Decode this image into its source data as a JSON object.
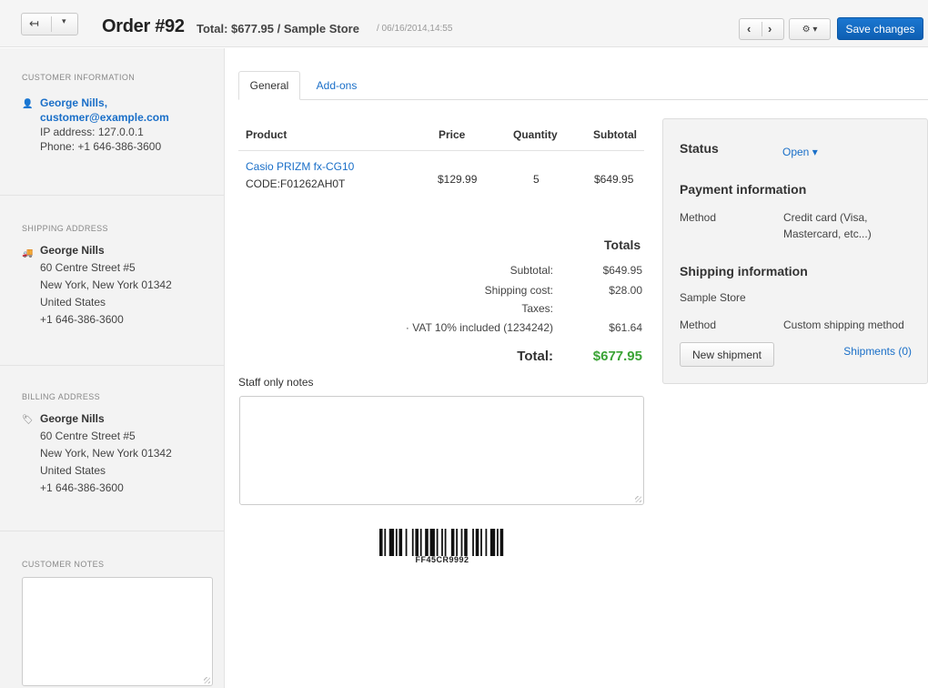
{
  "header": {
    "back_icon": "↤",
    "dropdown_icon": "▾",
    "title": "Order #92",
    "summary": "Total: $677.95 / Sample Store",
    "date": "/ 06/16/2014,14:55",
    "prev_icon": "‹",
    "next_icon": "›",
    "gear_icon": "⚙ ▾",
    "save_label": "Save changes"
  },
  "sidebar": {
    "customer": {
      "heading": "CUSTOMER INFORMATION",
      "icon": "👤",
      "name": "George Nills,",
      "email": "customer@example.com",
      "ip": "IP address: 127.0.0.1",
      "phone": "Phone: +1 646-386-3600"
    },
    "shipping": {
      "heading": "SHIPPING ADDRESS",
      "icon": "🚚",
      "name": "George Nills",
      "street": "60 Centre Street #5",
      "city": "New York, New York 01342",
      "country": "United States",
      "phone": "+1 646-386-3600"
    },
    "billing": {
      "heading": "BILLING ADDRESS",
      "icon": "🏷",
      "name": "George Nills",
      "street": "60 Centre Street #5",
      "city": "New York, New York 01342",
      "country": "United States",
      "phone": "+1 646-386-3600"
    },
    "notes_heading": "CUSTOMER NOTES",
    "notes_value": ""
  },
  "tabs": [
    {
      "label": "General",
      "active": true
    },
    {
      "label": "Add-ons",
      "active": false
    }
  ],
  "products": {
    "columns": [
      "Product",
      "Price",
      "Quantity",
      "Subtotal"
    ],
    "rows": [
      {
        "name": "Casio PRIZM fx-CG10",
        "code": "CODE:F01262AH0T",
        "price": "$129.99",
        "quantity": "5",
        "subtotal": "$649.95"
      }
    ]
  },
  "totals": {
    "title": "Totals",
    "subtotal_label": "Subtotal:",
    "subtotal_value": "$649.95",
    "shipping_label": "Shipping cost:",
    "shipping_value": "$28.00",
    "taxes_label": "Taxes:",
    "vat_label": "· VAT 10% included (1234242)",
    "vat_value": "$61.64",
    "total_label": "Total:",
    "total_value": "$677.95"
  },
  "staff_notes": {
    "label": "Staff only notes",
    "value": ""
  },
  "barcode": {
    "text": "FF45CR9992"
  },
  "info_panel": {
    "status_label": "Status",
    "status_value": "Open ▾",
    "payment_heading": "Payment information",
    "payment_method_label": "Method",
    "payment_method_value": "Credit card (Visa, Mastercard, etc...)",
    "shipping_heading": "Shipping information",
    "shipping_store": "Sample Store",
    "shipping_method_label": "Method",
    "shipping_method_value": "Custom shipping method",
    "new_shipment_label": "New shipment",
    "shipments_link": "Shipments (0)"
  },
  "colors": {
    "accent": "#1a6fc8",
    "save_button": "#1368c4",
    "total_green": "#3aa335"
  }
}
